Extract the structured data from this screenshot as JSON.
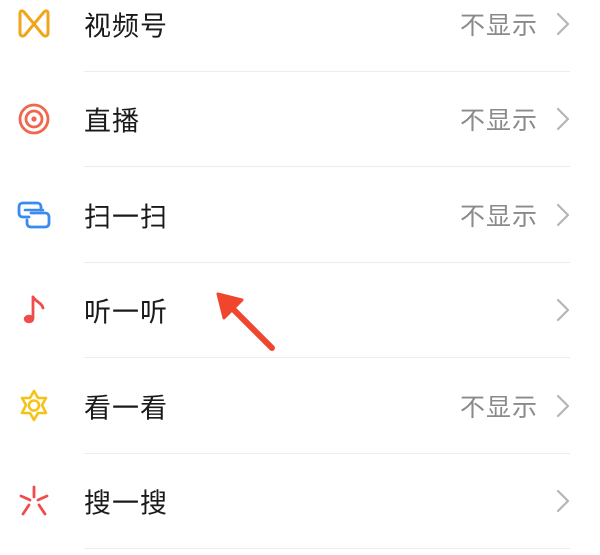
{
  "items": [
    {
      "label": "视频号",
      "value": "不显示",
      "icon": "channels-icon",
      "color": "#F2A51A"
    },
    {
      "label": "直播",
      "value": "不显示",
      "icon": "live-icon",
      "color": "#F0674D"
    },
    {
      "label": "扫一扫",
      "value": "不显示",
      "icon": "scan-icon",
      "color": "#3A8BF0"
    },
    {
      "label": "听一听",
      "value": "",
      "icon": "music-note-icon",
      "color": "#F04C4C"
    },
    {
      "label": "看一看",
      "value": "不显示",
      "icon": "top-stories-icon",
      "color": "#F5C318"
    },
    {
      "label": "搜一搜",
      "value": "",
      "icon": "search-sparkle-icon",
      "color": "#F04C4C"
    }
  ],
  "annotation": {
    "icon": "red-arrow-pointer",
    "color": "#F0462E"
  }
}
